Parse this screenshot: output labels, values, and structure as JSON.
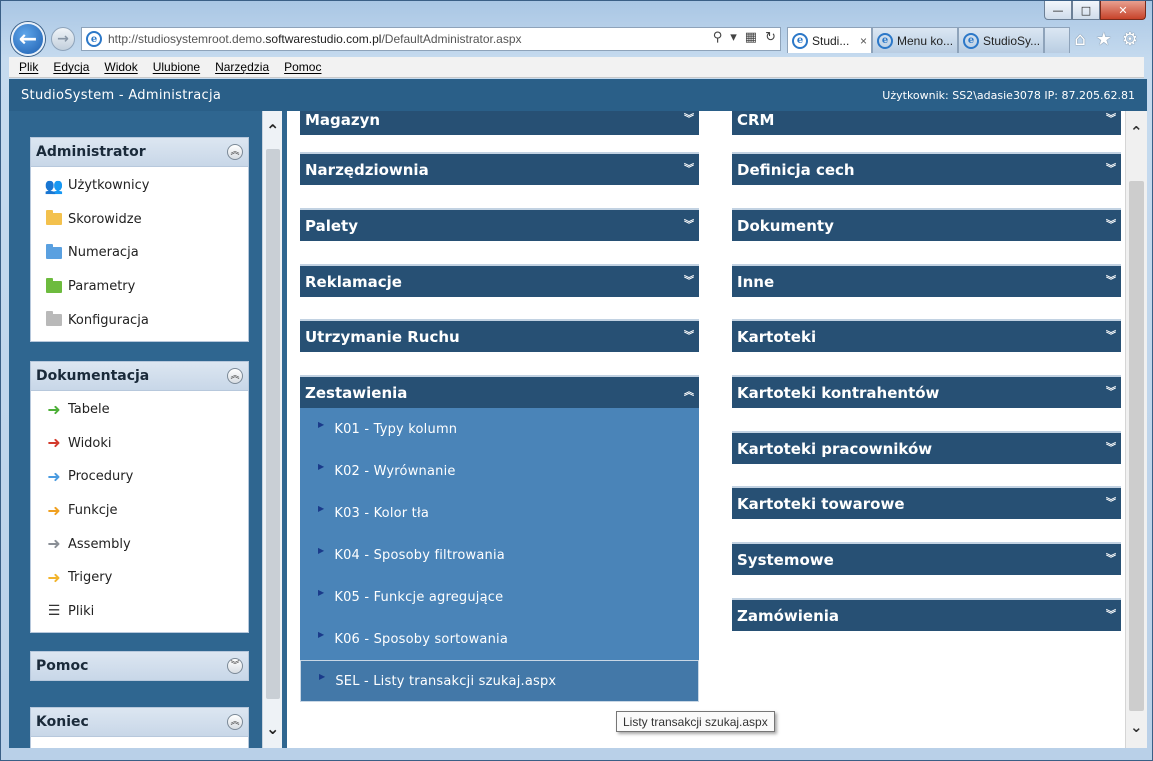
{
  "browser": {
    "url_prefix": "http://studiosystemroot.demo.",
    "url_domain": "softwarestudio.com.pl",
    "url_path": "/DefaultAdministrator.aspx",
    "tabs": [
      {
        "label": "Studi...",
        "close": "×",
        "active": true
      },
      {
        "label": "Menu ko...",
        "active": false
      },
      {
        "label": "StudioSy...",
        "active": false
      }
    ],
    "window_controls": {
      "minimize": "—",
      "maximize": "□",
      "close": "✕"
    },
    "menu": [
      "Plik",
      "Edycja",
      "Widok",
      "Ulubione",
      "Narzędzia",
      "Pomoc"
    ]
  },
  "app": {
    "title": "StudioSystem - Administracja",
    "user_info": "Użytkownik: SS2\\adasie3078 IP: 87.205.62.81"
  },
  "sidebar": {
    "administrator": {
      "title": "Administrator",
      "items": [
        {
          "label": "Użytkownicy",
          "icon": "users-icon"
        },
        {
          "label": "Skorowidze",
          "icon": "folder-icon",
          "color": "#f3c14d"
        },
        {
          "label": "Numeracja",
          "icon": "folder-icon",
          "color": "#5aa0e0"
        },
        {
          "label": "Parametry",
          "icon": "folder-icon",
          "color": "#6dbb3e"
        },
        {
          "label": "Konfiguracja",
          "icon": "folder-icon",
          "color": "#b9b9b9"
        }
      ]
    },
    "dokumentacja": {
      "title": "Dokumentacja",
      "items": [
        {
          "label": "Tabele",
          "icon": "arrow-right-icon",
          "color": "#4caf37"
        },
        {
          "label": "Widoki",
          "icon": "arrow-right-icon",
          "color": "#d33b2c"
        },
        {
          "label": "Procedury",
          "icon": "arrow-right-icon",
          "color": "#4a9be0"
        },
        {
          "label": "Funkcje",
          "icon": "arrow-right-icon",
          "color": "#f0a020"
        },
        {
          "label": "Assembly",
          "icon": "arrow-right-icon",
          "color": "#8a8f96"
        },
        {
          "label": "Trigery",
          "icon": "arrow-right-icon",
          "color": "#f2b42c"
        },
        {
          "label": "Pliki",
          "icon": "list-icon"
        }
      ]
    },
    "pomoc": {
      "title": "Pomoc"
    },
    "koniec": {
      "title": "Koniec"
    }
  },
  "sections_left": [
    {
      "title": "Magazyn"
    },
    {
      "title": "Narzędziownia"
    },
    {
      "title": "Palety"
    },
    {
      "title": "Reklamacje"
    },
    {
      "title": "Utrzymanie Ruchu"
    },
    {
      "title": "Zestawienia",
      "expanded": true
    }
  ],
  "zestawienia_items": [
    "K01 - Typy kolumn",
    "K02 - Wyrównanie",
    "K03 - Kolor tła",
    "K04 - Sposoby filtrowania",
    "K05 - Funkcje agregujące",
    "K06 - Sposoby sortowania",
    "SEL - Listy transakcji szukaj.aspx"
  ],
  "sections_right": [
    {
      "title": "CRM"
    },
    {
      "title": "Definicja cech"
    },
    {
      "title": "Dokumenty"
    },
    {
      "title": "Inne"
    },
    {
      "title": "Kartoteki"
    },
    {
      "title": "Kartoteki kontrahentów"
    },
    {
      "title": "Kartoteki pracowników"
    },
    {
      "title": "Kartoteki towarowe"
    },
    {
      "title": "Systemowe"
    },
    {
      "title": "Zamówienia"
    }
  ],
  "tooltip": "Listy transakcji szukaj.aspx"
}
